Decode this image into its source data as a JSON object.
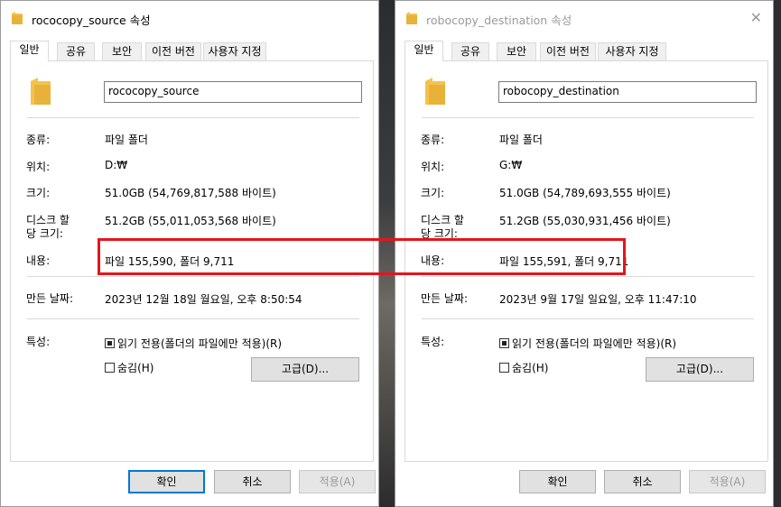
{
  "colors": {
    "highlight": "#e3161d",
    "accent": "#0078d7",
    "folder": "#f4c24d"
  },
  "left": {
    "title": "rococopy_source 속성",
    "tabs": [
      "일반",
      "공유",
      "보안",
      "이전 버전",
      "사용자 지정"
    ],
    "name": "rococopy_source",
    "labels": {
      "type": "종류:",
      "location": "위치:",
      "size": "크기:",
      "disk1": "디스크 할",
      "disk2": "당 크기:",
      "contents": "내용:",
      "created": "만든 날짜:",
      "attributes": "특성:"
    },
    "values": {
      "type": "파일 폴더",
      "location": "D:₩",
      "size": "51.0GB (54,769,817,588 바이트)",
      "disk": "51.2GB (55,011,053,568 바이트)",
      "contents": "파일 155,590, 폴더 9,711",
      "created": "2023년 12월 18일 월요일, 오후 8:50:54"
    },
    "readonly": "읽기 전용(폴더의 파일에만 적용)(R)",
    "hidden": "숨김(H)",
    "advanced": "고급(D)...",
    "ok": "확인",
    "cancel": "취소",
    "apply": "적용(A)"
  },
  "right": {
    "title": "robocopy_destination 속성",
    "tabs": [
      "일반",
      "공유",
      "보안",
      "이전 버전",
      "사용자 지정"
    ],
    "name": "robocopy_destination",
    "labels": {
      "type": "종류:",
      "location": "위치:",
      "size": "크기:",
      "disk1": "디스크 할",
      "disk2": "당 크기:",
      "contents": "내용:",
      "created": "만든 날짜:",
      "attributes": "특성:"
    },
    "values": {
      "type": "파일 폴더",
      "location": "G:₩",
      "size": "51.0GB (54,789,693,555 바이트)",
      "disk": "51.2GB (55,030,931,456 바이트)",
      "contents": "파일 155,591, 폴더 9,711",
      "created": "2023년 9월 17일 일요일, 오후 11:47:10"
    },
    "readonly": "읽기 전용(폴더의 파일에만 적용)(R)",
    "hidden": "숨김(H)",
    "advanced": "고급(D)...",
    "ok": "확인",
    "cancel": "취소",
    "apply": "적용(A)"
  }
}
